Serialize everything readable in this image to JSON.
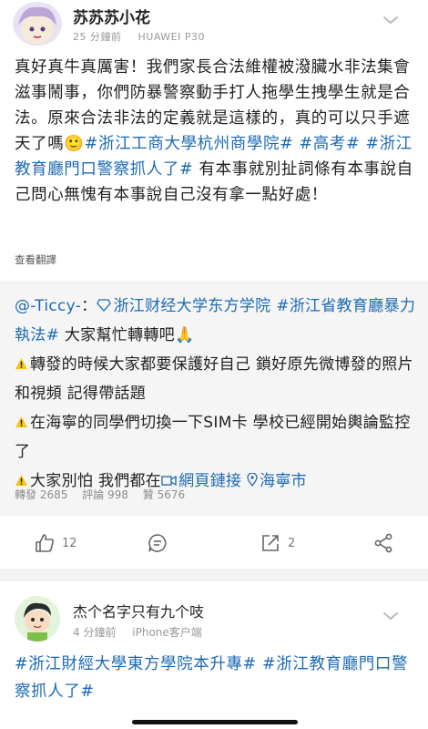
{
  "post1": {
    "username": "苏苏苏小花",
    "time": "25 分鐘前",
    "device": "HUAWEI P30",
    "text_a": "真好真牛真厲害！我們家長合法維權被潑臟水非法集會滋事鬧事，你們防暴警察動手打人拖學生拽學生就是合法。原來合法非法的定義就是這樣的，真的可以只手遮天了嗎",
    "tag_1": "#浙江工商大學杭州商學院#",
    "tag_2": "#高考#",
    "tag_3": "#浙江教育廳門口警察抓人了#",
    "text_b": "有本事就別扯詞條有本事說自己問心無愧有本事說自己沒有拿一點好處！",
    "translate": "查看翻譯"
  },
  "repost": {
    "author": "@-Ticcy-",
    "colon": "：",
    "tag_1": "浙江财经大学东方学院",
    "tag_2": "#浙江省教育廳暴力執法#",
    "line1_end": "大家幫忙轉轉吧",
    "warn1": "轉發的時候大家都要保護好自己 鎖好原先微博發的照片和視頻 記得帶話題",
    "warn2": "在海寧的同學們切換一下SIM卡 學校已經開始輿論監控了",
    "warn3": "大家別怕 我們都在",
    "link_web": "網頁鏈接",
    "link_loc": "海寧市",
    "stat_repost": "轉發 2685",
    "stat_comment": "評論 998",
    "stat_like": "贊 5676"
  },
  "actions": {
    "like_count": "12",
    "repost_count": "2"
  },
  "post2": {
    "username": "杰个名字只有九个吱",
    "time": "4 分鐘前",
    "device": "iPhone客户端",
    "text": "#浙江財經大學東方學院本升專# #浙江教育廳門口警察抓人了#"
  },
  "colors": {
    "link": "#1d6ab4",
    "repost_bg": "#f5f5f5"
  }
}
